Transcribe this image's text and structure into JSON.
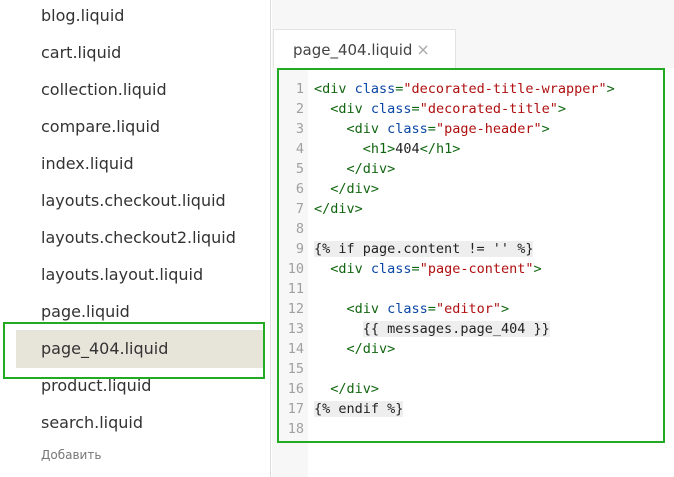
{
  "sidebar": {
    "files": [
      {
        "label": "blog.liquid",
        "active": false
      },
      {
        "label": "cart.liquid",
        "active": false
      },
      {
        "label": "collection.liquid",
        "active": false
      },
      {
        "label": "compare.liquid",
        "active": false
      },
      {
        "label": "index.liquid",
        "active": false
      },
      {
        "label": "layouts.checkout.liquid",
        "active": false
      },
      {
        "label": "layouts.checkout2.liquid",
        "active": false
      },
      {
        "label": "layouts.layout.liquid",
        "active": false
      },
      {
        "label": "page.liquid",
        "active": false
      },
      {
        "label": "page_404.liquid",
        "active": true
      },
      {
        "label": "product.liquid",
        "active": false
      },
      {
        "label": "search.liquid",
        "active": false
      }
    ],
    "add_label": "Добавить"
  },
  "editor": {
    "tab_label": "page_404.liquid",
    "close_glyph": "×",
    "line_numbers": [
      "1",
      "2",
      "3",
      "4",
      "5",
      "6",
      "7",
      "8",
      "9",
      "10",
      "11",
      "12",
      "13",
      "14",
      "15",
      "16",
      "17",
      "18"
    ],
    "lines": [
      "<div class=\"decorated-title-wrapper\">",
      "  <div class=\"decorated-title\">",
      "    <div class=\"page-header\">",
      "      <h1>404</h1>",
      "    </div>",
      "  </div>",
      "</div>",
      "",
      "{% if page.content != '' %}",
      "  <div class=\"page-content\">",
      "",
      "    <div class=\"editor\">",
      "      {{ messages.page_404 }}",
      "    </div>",
      "",
      "  </div>",
      "{% endif %}",
      ""
    ]
  },
  "colors": {
    "highlight": "#22aa22",
    "active_row": "#e7e4da",
    "tag": "#116611",
    "attr": "#0b47a5",
    "string": "#b01010"
  }
}
